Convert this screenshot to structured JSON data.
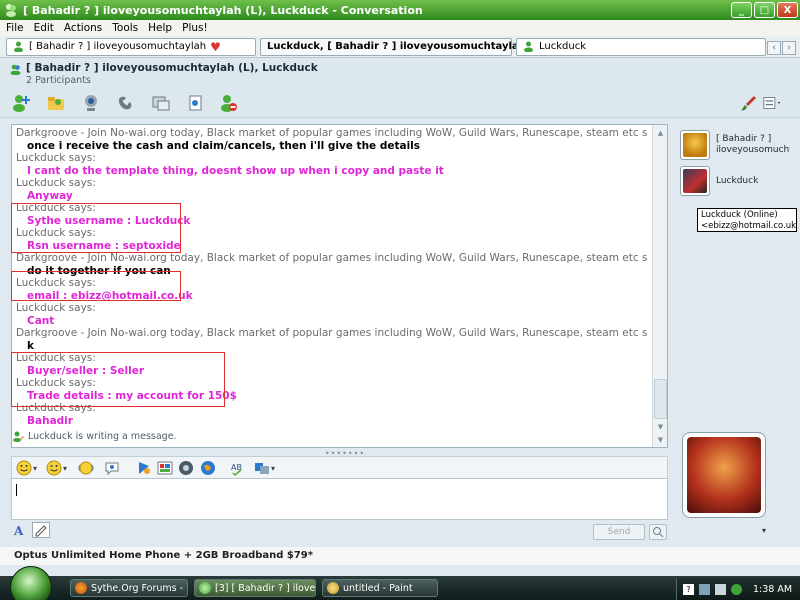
{
  "window": {
    "title": "[ Bahadir ? ] iloveyousomuchtaylah (L), Luckduck - Conversation",
    "controls": [
      "_",
      "□",
      "X"
    ]
  },
  "menu": [
    "File",
    "Edit",
    "Actions",
    "Tools",
    "Help",
    "Plus!"
  ],
  "tabs": [
    {
      "label": "[ Bahadir ? ] iloveyousomuchtaylah",
      "heart": "♥"
    },
    {
      "label": "Luckduck, [ Bahadir ? ] iloveyousomuchtaylah",
      "heart": "♥"
    },
    {
      "label": "Luckduck",
      "heart": ""
    }
  ],
  "tab_nav": [
    "‹",
    "›"
  ],
  "header": {
    "title": "[ Bahadir ? ] iloveyousomuchtaylah (L), Luckduck",
    "subtitle": "2 Participants"
  },
  "toolbar_icons": [
    "invite-icon",
    "send-files-icon",
    "video-icon",
    "call-icon",
    "activities-icon",
    "games-icon",
    "block-icon",
    "paint-brush-icon",
    "layout-icon"
  ],
  "chat": {
    "lines": [
      {
        "kind": "says",
        "text": "Darkgroove - Join No-wai.org today, Black market of popular games including WoW, Guild Wars, Runescape, steam etc says:"
      },
      {
        "kind": "msg",
        "color": "black",
        "text": "once i receive the cash and claim/cancels, then i'll give the details"
      },
      {
        "kind": "says",
        "text": "Luckduck says:"
      },
      {
        "kind": "msg",
        "color": "pink",
        "text": "I cant do the template thing, doesnt show up when i copy and paste it"
      },
      {
        "kind": "says",
        "text": "Luckduck says:"
      },
      {
        "kind": "msg",
        "color": "pink",
        "text": "Anyway"
      },
      {
        "kind": "says",
        "text": "Luckduck says:"
      },
      {
        "kind": "msg",
        "color": "pink",
        "text": "Sythe username : Luckduck"
      },
      {
        "kind": "says",
        "text": "Luckduck says:"
      },
      {
        "kind": "msg",
        "color": "pink",
        "text": "Rsn username : septoxide"
      },
      {
        "kind": "says",
        "text": "Darkgroove - Join No-wai.org today, Black market of popular games including WoW, Guild Wars, Runescape, steam etc says:"
      },
      {
        "kind": "msg",
        "color": "black",
        "text": "do it together if you can"
      },
      {
        "kind": "says",
        "text": "Luckduck says:"
      },
      {
        "kind": "msg",
        "color": "pink",
        "text": "email : ebizz@hotmail.co.uk"
      },
      {
        "kind": "says",
        "text": "Luckduck says:"
      },
      {
        "kind": "msg",
        "color": "pink",
        "text": "Cant"
      },
      {
        "kind": "says",
        "text": "Darkgroove - Join No-wai.org today, Black market of popular games including WoW, Guild Wars, Runescape, steam etc says:"
      },
      {
        "kind": "msg",
        "color": "black",
        "text": "k"
      },
      {
        "kind": "says",
        "text": "Luckduck says:"
      },
      {
        "kind": "msg",
        "color": "pink",
        "text": "Buyer/seller : Seller"
      },
      {
        "kind": "says",
        "text": "Luckduck says:"
      },
      {
        "kind": "msg",
        "color": "pink",
        "text": "Trade details : my account for 150$"
      },
      {
        "kind": "says",
        "text": "Luckduck says:"
      },
      {
        "kind": "msg",
        "color": "pink",
        "text": "Bahadir"
      }
    ],
    "typing_status": "Luckduck is writing a message.",
    "grip": "•••••••"
  },
  "input": {
    "value": "",
    "send_label": "Send",
    "font_label": "A"
  },
  "ad": "Optus Unlimited Home Phone + 2GB Broadband $79*",
  "participants": [
    {
      "name": "[ Bahadir ? ] iloveyousomucht"
    },
    {
      "name": "Luckduck"
    }
  ],
  "tooltip": {
    "line1": "Luckduck (Online)",
    "line2": "<ebizz@hotmail.co.uk>"
  },
  "avatar_menu": "▾",
  "taskbar": {
    "items": [
      {
        "label": "Sythe.Org Forums - P...",
        "active": false
      },
      {
        "label": "[3] [ Bahadir ? ] ilovey...",
        "active": true
      },
      {
        "label": "untitled - Paint",
        "active": false
      }
    ],
    "clock": "1:38 AM"
  },
  "colors": {
    "pink": "#e025d6",
    "titlebar": "#2f8a1f",
    "highlight_box": "#e03030"
  }
}
